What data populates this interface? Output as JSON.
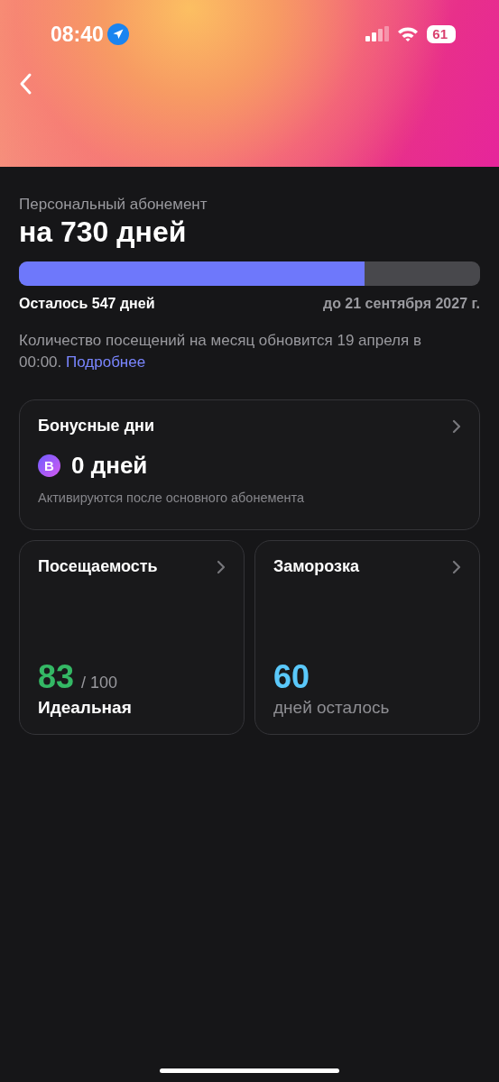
{
  "status_bar": {
    "time": "08:40",
    "battery": "61"
  },
  "subscription": {
    "caption": "Персональный абонемент",
    "title": "на 730 дней",
    "progress": {
      "level": 0.75
    },
    "remaining": "Осталось 547 дней",
    "until": "до 21 сентября 2027 г.",
    "note": "Количество посещений на месяц обновится 19 апреля в 00:00.",
    "note_link": "Подробнее"
  },
  "bonus_card": {
    "title": "Бонусные дни",
    "badge": "В",
    "value": "0 дней",
    "hint": "Активируются после основного абонемента"
  },
  "stat_cards": [
    {
      "kind": "score",
      "title": "Посещаемость",
      "value": "83",
      "suffix": "/ 100",
      "label": "Идеальная",
      "color": "#34b865"
    },
    {
      "kind": "remaining",
      "title": "Заморозка",
      "value": "60",
      "label": "дней осталось",
      "color": "#5ac8fa"
    }
  ]
}
